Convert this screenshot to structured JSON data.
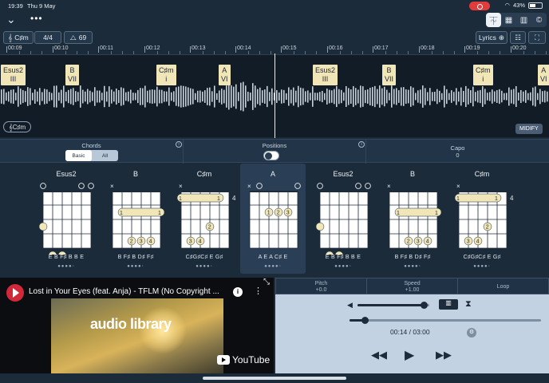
{
  "status": {
    "time": "19:39",
    "date": "Thu 9 May",
    "battery": "43%"
  },
  "top": {
    "more": "•••",
    "key": "C♯m",
    "time_sig": "4/4",
    "tempo": "69",
    "lyrics": "Lyrics"
  },
  "ruler": [
    "00:09",
    "00:10",
    "00:11",
    "00:12",
    "00:13",
    "00:14",
    "00:15",
    "00:16",
    "00:17",
    "00:18",
    "00:19",
    "00:20"
  ],
  "timeline_chords": [
    {
      "name": "Esus2",
      "roman": "III"
    },
    {
      "name": "B",
      "roman": "VII"
    },
    {
      "name": "C♯m",
      "roman": "i"
    },
    {
      "name": "A",
      "roman": "VI"
    },
    {
      "name": "Esus2",
      "roman": "III"
    },
    {
      "name": "B",
      "roman": "VII"
    },
    {
      "name": "C♯m",
      "roman": "i"
    },
    {
      "name": "A",
      "roman": "VI"
    }
  ],
  "key_chip": "C♯m",
  "midify": "MIDIFY",
  "panel": {
    "chords_label": "Chords",
    "basic": "Basic",
    "all": "All",
    "positions_label": "Positions",
    "capo_label": "Capo",
    "capo_value": "0"
  },
  "chord_diagrams": [
    {
      "name": "Esus2",
      "notes": "E  B  F♯  B  B  E"
    },
    {
      "name": "B",
      "notes": "B  F♯  B  D♯  F♯"
    },
    {
      "name": "C♯m",
      "notes": "C♯G♯C♯ E  G♯"
    },
    {
      "name": "A",
      "notes": "A  E  A  C♯  E"
    },
    {
      "name": "Esus2",
      "notes": "E  B  F♯  B  B  E"
    },
    {
      "name": "B",
      "notes": "B  F♯  B  D♯  F♯"
    },
    {
      "name": "C♯m",
      "notes": "C♯G♯C♯ E  G♯"
    }
  ],
  "video": {
    "title": "Lost in Your Eyes (feat. Anja) - TFLM (No Copyright ...",
    "overlay": "audio library",
    "brand": "YouTube"
  },
  "player": {
    "pitch_label": "Pitch",
    "pitch_value": "+0.0",
    "speed_label": "Speed",
    "speed_value": "+1.00",
    "loop_label": "Loop",
    "time": "00:14 / 03:00",
    "volume": 0.92,
    "progress": 0.078
  },
  "colors": {
    "bg": "#1c2b3a",
    "chord_box": "#f1e6b8",
    "player_bg": "#c3d2e3"
  }
}
